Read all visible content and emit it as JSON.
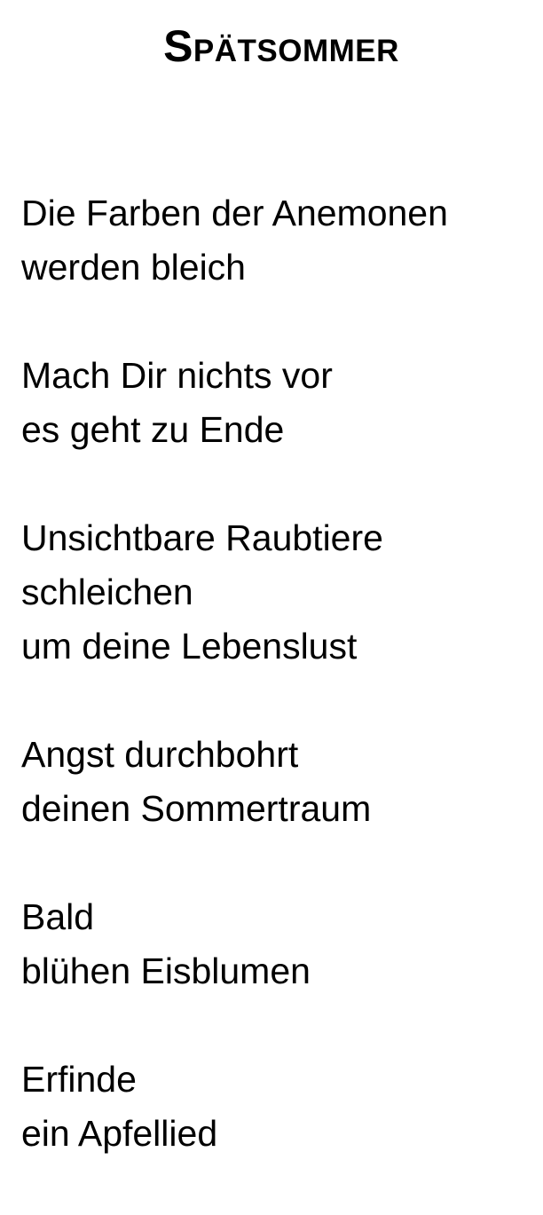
{
  "poem": {
    "title": "Spätsommer",
    "stanzas": [
      {
        "lines": [
          "Die Farben der Anemonen",
          "werden bleich"
        ]
      },
      {
        "lines": [
          "Mach Dir nichts vor",
          "es geht zu Ende"
        ]
      },
      {
        "lines": [
          "Unsichtbare Raubtiere",
          "schleichen",
          "um deine Lebenslust"
        ]
      },
      {
        "lines": [
          "Angst durchbohrt",
          "deinen Sommertraum"
        ]
      },
      {
        "lines": [
          "Bald",
          "blühen Eisblumen"
        ]
      },
      {
        "lines": [
          "Erfinde",
          "ein Apfellied"
        ]
      }
    ]
  }
}
